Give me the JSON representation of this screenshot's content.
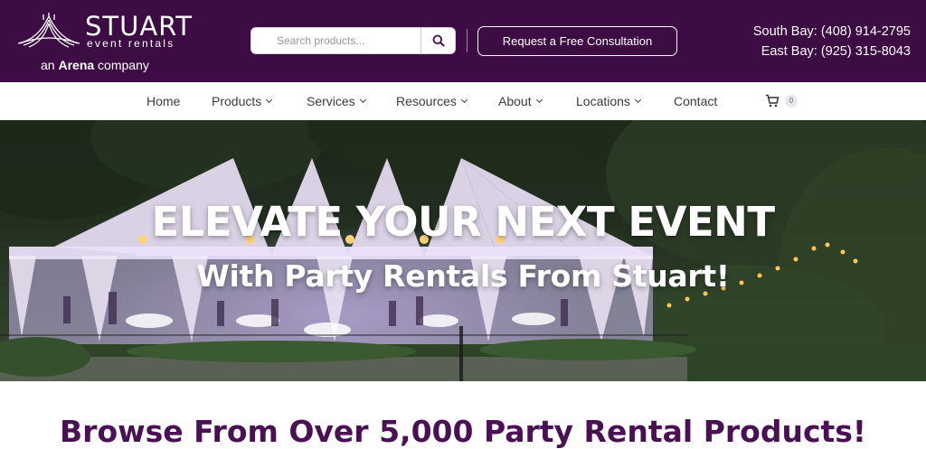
{
  "brand": {
    "name": "STUART",
    "tagline": "event rentals",
    "parent_prefix": "an",
    "parent_name": "Arena",
    "parent_suffix": "company"
  },
  "search": {
    "placeholder": "Search products...",
    "icon": "search-icon"
  },
  "header": {
    "cta_label": "Request a Free Consultation",
    "phones": [
      "South Bay: (408) 914-2795",
      "East Bay: (925) 315-8043"
    ]
  },
  "nav": {
    "items": [
      {
        "label": "Home",
        "dropdown": false
      },
      {
        "label": "Products",
        "dropdown": true
      },
      {
        "label": "Services",
        "dropdown": true
      },
      {
        "label": "Resources",
        "dropdown": true
      },
      {
        "label": "About",
        "dropdown": true
      },
      {
        "label": "Locations",
        "dropdown": true
      },
      {
        "label": "Contact",
        "dropdown": false
      }
    ],
    "cart_count": "0",
    "cart_icon": "cart-icon"
  },
  "hero": {
    "title": "ELEVATE YOUR NEXT EVENT",
    "subtitle": "With Party Rentals From Stuart!"
  },
  "browse": {
    "heading": "Browse From Over 5,000 Party Rental Products!"
  },
  "colors": {
    "brand_purple": "#3d0c45",
    "heading_purple": "#4a0f55",
    "white": "#ffffff"
  }
}
